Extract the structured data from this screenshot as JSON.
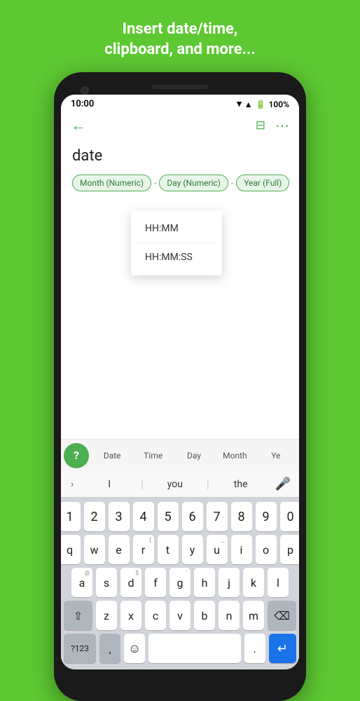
{
  "header": {
    "title": "Insert date/time,\nclipboard, and more..."
  },
  "status_bar": {
    "time": "10:00",
    "battery": "100%"
  },
  "nav": {
    "back": "←",
    "filter_icon": "⊟",
    "more_icon": "⋯"
  },
  "content": {
    "date_label": "date",
    "tags": [
      "Month (Numeric)",
      "Day (Numeric)",
      "Year (Full)"
    ],
    "dropdown_items": [
      "HH:MM",
      "HH:MM:SS"
    ]
  },
  "toolbar": {
    "help": "?",
    "items": [
      "Date",
      "Time",
      "Day",
      "Month",
      "Ye"
    ]
  },
  "suggestions": {
    "items": [
      "I",
      "you",
      "the"
    ]
  },
  "keyboard": {
    "num_row": [
      "1",
      "2",
      "3",
      "4",
      "5",
      "6",
      "7",
      "8",
      "9",
      "0"
    ],
    "row2": [
      {
        "key": "q"
      },
      {
        "key": "w"
      },
      {
        "key": "e"
      },
      {
        "key": "r",
        "sup": "["
      },
      {
        "key": "t"
      },
      {
        "key": "y"
      },
      {
        "key": "u",
        "sup": "_"
      },
      {
        "key": "i"
      },
      {
        "key": "o"
      },
      {
        "key": "p"
      }
    ],
    "row3": [
      {
        "key": "a",
        "sup": "@"
      },
      {
        "key": "s"
      },
      {
        "key": "d",
        "sup": "$"
      },
      {
        "key": "f"
      },
      {
        "key": "g",
        "sup": "`"
      },
      {
        "key": "h"
      },
      {
        "key": "j"
      },
      {
        "key": "k"
      },
      {
        "key": "l"
      }
    ],
    "row4": {
      "shift": "⇧",
      "keys": [
        "z",
        "x",
        "c",
        "v",
        "b",
        "n",
        "m"
      ],
      "delete": "⌫"
    },
    "bottom_row": {
      "num": "?123",
      "comma": ",",
      "emoji": "☺",
      "space": "",
      "period": ".",
      "enter": "←"
    }
  }
}
